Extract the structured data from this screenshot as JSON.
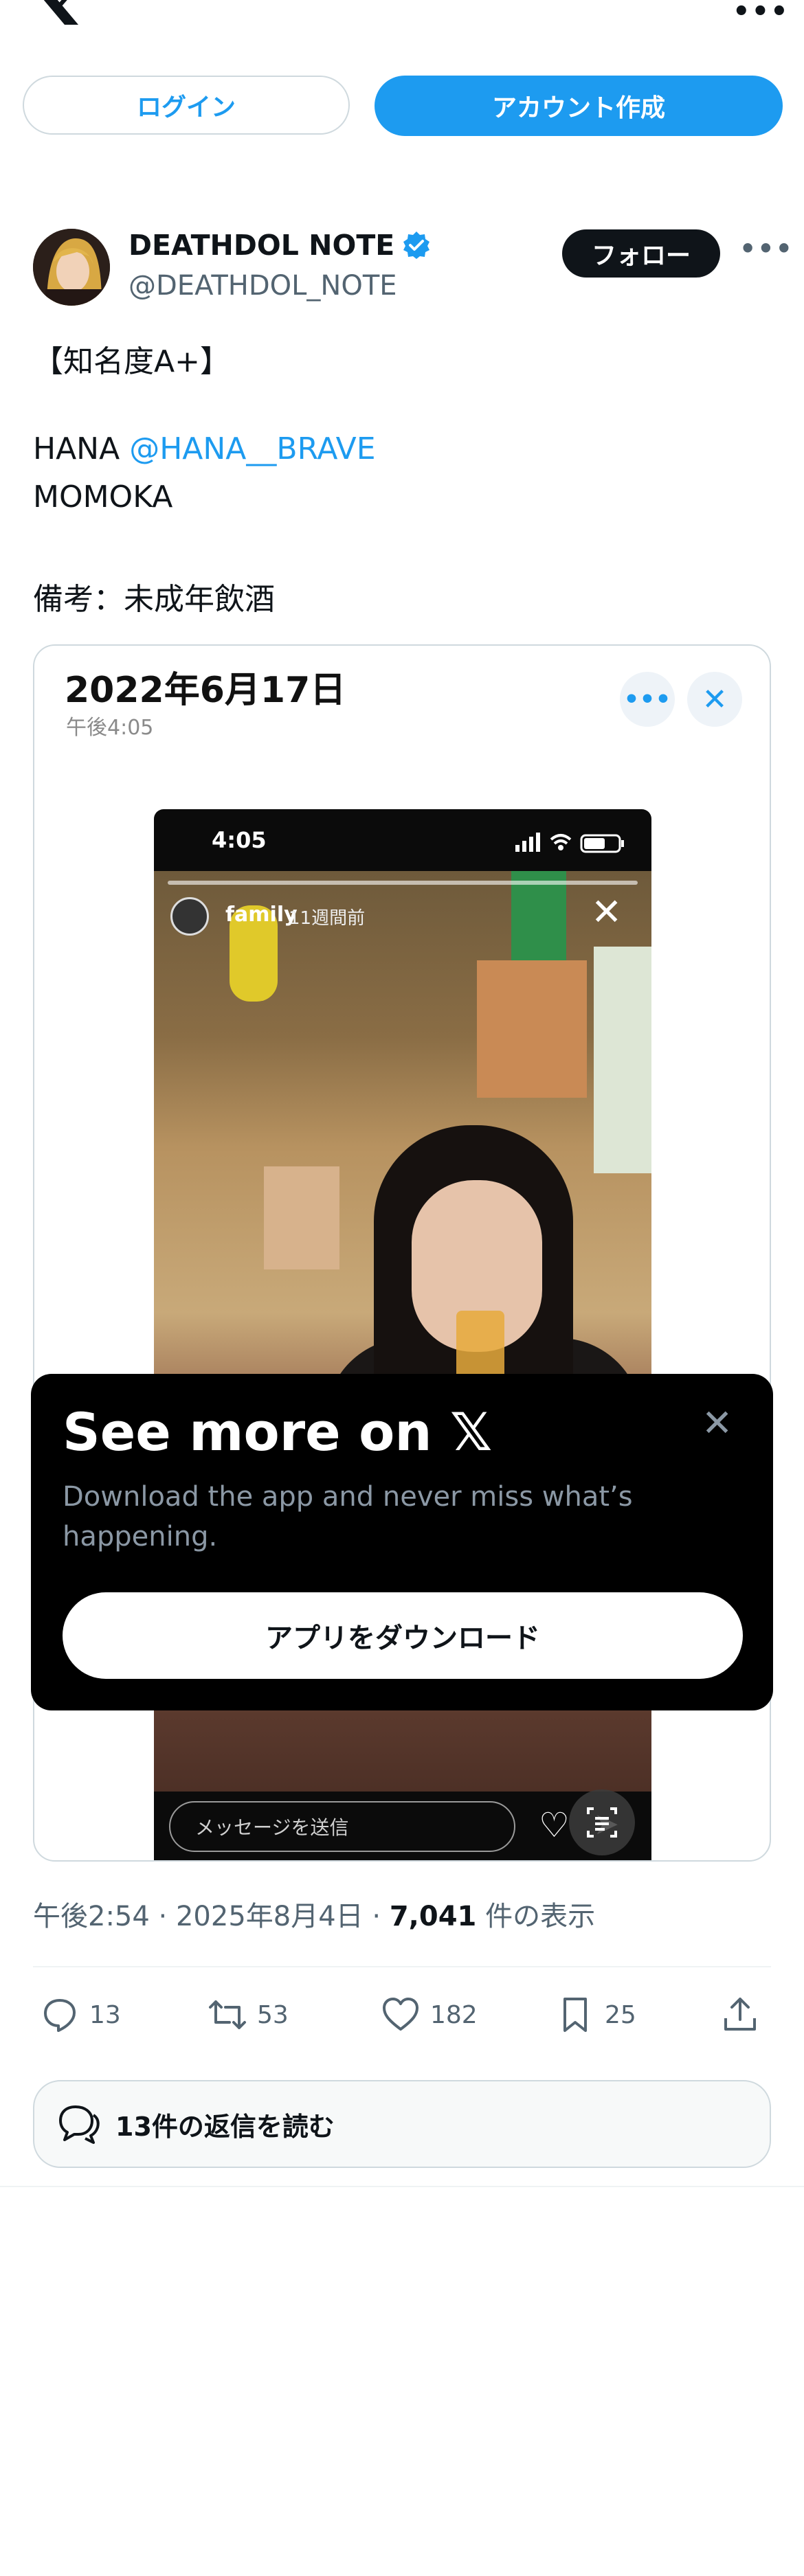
{
  "top_bar": {
    "logo": "X",
    "more_icon": "more-horizontal-icon"
  },
  "auth": {
    "login_label": "ログイン",
    "signup_label": "アカウント作成"
  },
  "post": {
    "author_name": "DEATHDOL NOTE",
    "author_handle": "@DEATHDOL_NOTE",
    "follow_label": "フォロー",
    "text_lines": {
      "line1": "【知名度A+】",
      "line2_prefix": "HANA ",
      "line2_mention": "@HANA__BRAVE",
      "line3": "MOMOKA",
      "line4": "備考：未成年飲酒"
    },
    "media": {
      "date": "2022年6月17日",
      "time": "午後4:05",
      "phone_time": "4:05",
      "story_user": "family",
      "story_age": "11週間前",
      "message_placeholder": "メッセージを送信"
    },
    "meta": {
      "time": "午後2:54",
      "date": "2025年8月4日",
      "views_count": "7,041",
      "views_label": "件の表示",
      "sep": " · "
    },
    "actions": {
      "replies": "13",
      "reposts": "53",
      "likes": "182",
      "bookmarks": "25"
    },
    "read_replies_label": "13件の返信を読む"
  },
  "overlay": {
    "title": "See more on 𝕏",
    "description": "Download the app and never miss what’s happening.",
    "download_label": "アプリをダウンロード"
  },
  "colors": {
    "accent": "#1d9bf0",
    "text": "#0f1419",
    "secondary": "#536471",
    "border": "#cfd9de"
  }
}
